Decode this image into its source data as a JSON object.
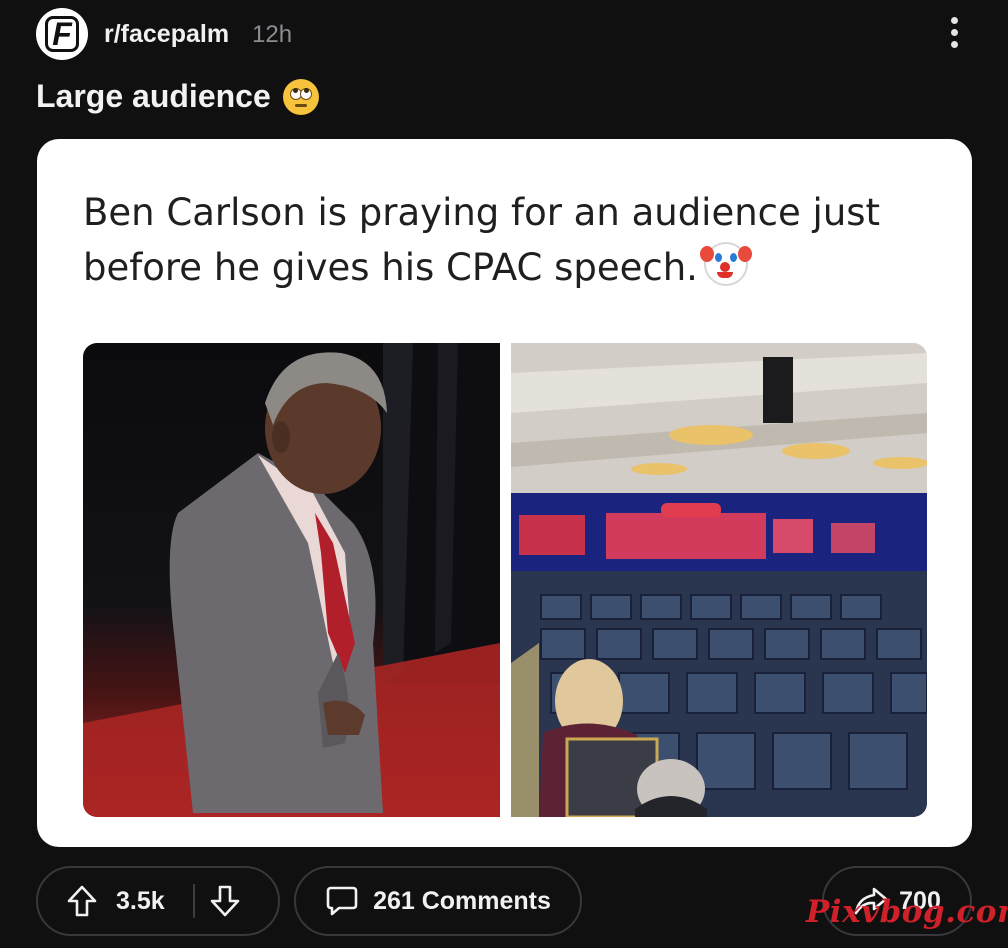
{
  "post": {
    "subreddit": "r/facepalm",
    "age": "12h",
    "avatar_letter": "F",
    "title": "Large audience",
    "title_emoji": "face-with-rolling-eyes-emoji"
  },
  "card": {
    "tweet_text": "Ben Carlson is praying for an audience just before he gives his CPAC speech.",
    "tweet_emoji": "clown-face-emoji",
    "images": [
      "Man in grey suit and red tie, head bowed, standing beside a dark curtain on red carpet",
      "Conference hall with rows of mostly empty chairs facing a CPAC stage"
    ]
  },
  "actions": {
    "upvotes": "3.5k",
    "comments_label": "261 Comments",
    "shares": "700"
  },
  "watermark": "Pixvbog.com",
  "colors": {
    "background": "#101011",
    "card_background": "#ffffff",
    "pill_border": "#37383b",
    "watermark": "#d0202a"
  }
}
